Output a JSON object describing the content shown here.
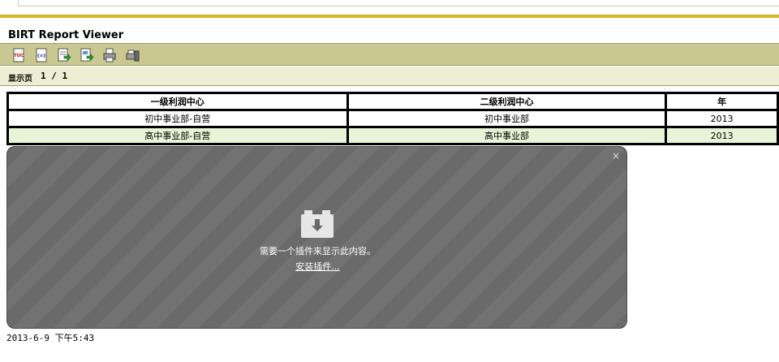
{
  "viewer": {
    "title": "BIRT Report Viewer"
  },
  "toolbar": {
    "buttons": [
      {
        "name": "toc-icon"
      },
      {
        "name": "parameter-icon"
      },
      {
        "name": "export-data-icon"
      },
      {
        "name": "export-report-icon"
      },
      {
        "name": "print-icon"
      },
      {
        "name": "print-server-icon"
      }
    ]
  },
  "navigation": {
    "page_label": "显示页",
    "current_page": "1",
    "separator": "/",
    "total_pages": "1"
  },
  "table": {
    "headers": [
      "一级利润中心",
      "二级利润中心",
      "年"
    ],
    "rows": [
      [
        "初中事业部-自营",
        "初中事业部",
        "2013"
      ],
      [
        "高中事业部-自营",
        "高中事业部",
        "2013"
      ]
    ]
  },
  "plugin": {
    "message": "需要一个插件来显示此内容。",
    "install_link": "安装插件...",
    "close_symbol": "×"
  },
  "footer": {
    "timestamp": "2013-6-9 下午5:43"
  },
  "colors": {
    "accent_line": "#d4b82a",
    "toolbar_bg": "#c8c890",
    "nav_bg": "#eeeed4",
    "row_alt": "#e8f4d8",
    "plugin_bg": "#6a6a6a"
  }
}
